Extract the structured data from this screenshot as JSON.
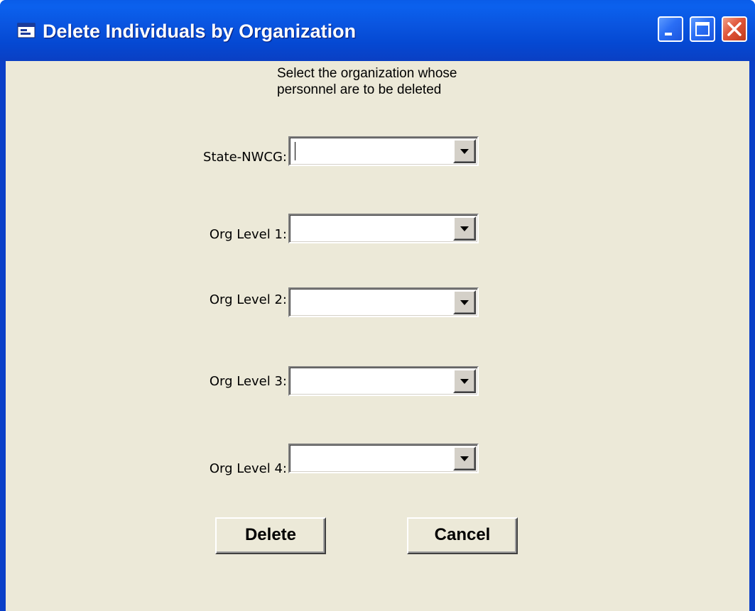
{
  "window": {
    "title": "Delete Individuals by Organization",
    "app_icon": "form-icon",
    "minimize_icon": "minimize-icon",
    "maximize_icon": "maximize-icon",
    "close_icon": "close-icon",
    "colors": {
      "titlebar": "#0a55e0",
      "client_background": "#ece9d8",
      "close_button": "#e0563a"
    }
  },
  "form": {
    "instruction": "Select the organization whose personnel are to be deleted",
    "fields": [
      {
        "label": "State-NWCG:",
        "value": ""
      },
      {
        "label": "Org Level 1:",
        "value": ""
      },
      {
        "label": "Org Level 2:",
        "value": ""
      },
      {
        "label": "Org Level 3:",
        "value": ""
      },
      {
        "label": "Org Level 4:",
        "value": ""
      }
    ],
    "dropdown_icon": "chevron-down-icon"
  },
  "buttons": {
    "delete_label": "Delete",
    "cancel_label": "Cancel"
  }
}
